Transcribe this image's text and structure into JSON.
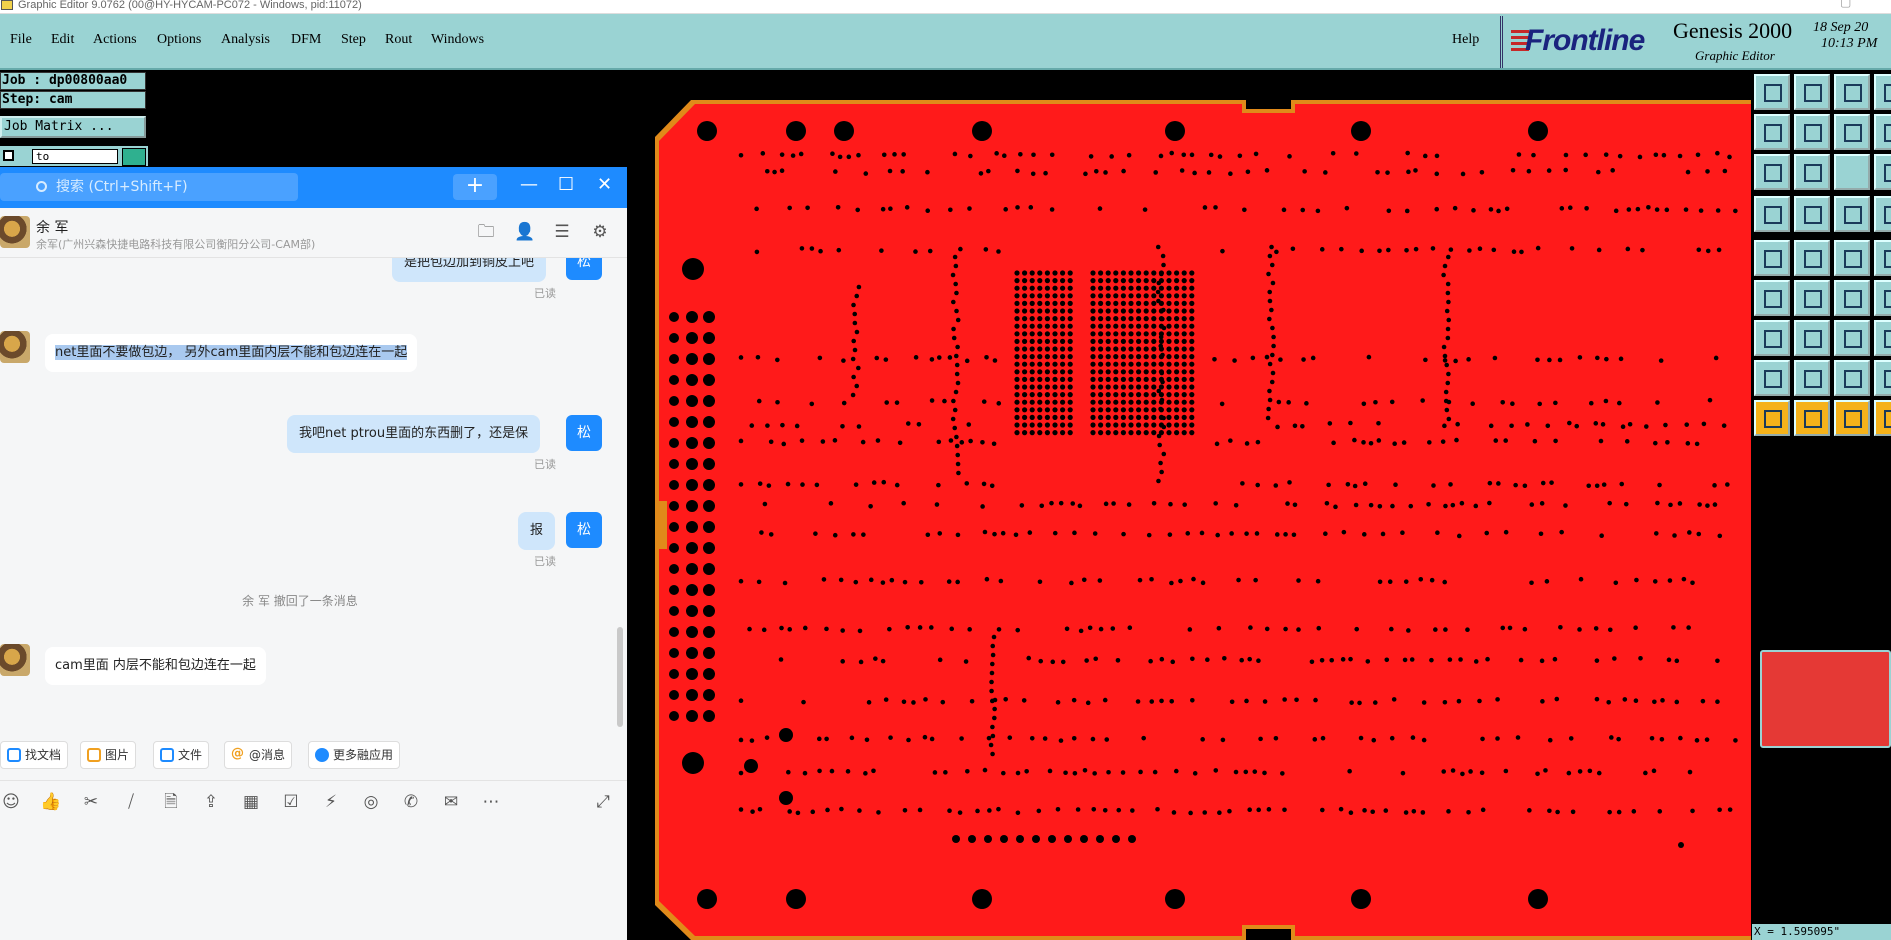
{
  "window": {
    "title": "Graphic Editor 9.0762 (00@HY-HYCAM-PC072 - Windows, pid:11072)"
  },
  "menu": {
    "items": [
      "File",
      "Edit",
      "Actions",
      "Options",
      "Analysis",
      "DFM",
      "Step",
      "Rout",
      "Windows"
    ],
    "help": "Help"
  },
  "brand": {
    "logo": "Frontline",
    "product": "Genesis 2000",
    "subtitle": "Graphic Editor",
    "date": "18 Sep 20",
    "time": "10:13 PM"
  },
  "job": {
    "job_line": "Job : dp00800aa0",
    "step_line": "Step: cam",
    "job_matrix": "Job Matrix ...",
    "filter_value": "to"
  },
  "chat": {
    "search_placeholder": "搜索 (Ctrl+Shift+F)",
    "contact_name": "余 军",
    "contact_sub": "余军(广州兴森快捷电路科技有限公司衡阳分公司-CAM部)",
    "my_avatar": "松",
    "messages": [
      {
        "text": "是把包边加到铜皮上吧",
        "read": "已读"
      },
      {
        "text": "net里面不要做包边， 另外cam里面内层不能和包边连在一起"
      },
      {
        "text": "我吧net ptrou里面的东西删了，还是保",
        "read": "已读"
      },
      {
        "text": "报",
        "read": "已读"
      },
      {
        "system": "余 军 撤回了一条消息"
      },
      {
        "text": "cam里面 内层不能和包边连在一起"
      }
    ],
    "quick": [
      "找文档",
      "图片",
      "文件",
      "@消息",
      "更多融应用"
    ],
    "colors": {
      "accent": "#1e8bff",
      "bubble_mine": "#cfe6fb"
    }
  },
  "canvas": {
    "board_color": "#ff1a1a",
    "outline_color": "#e08a1a"
  },
  "status": {
    "coord": "X = 1.595095\""
  }
}
